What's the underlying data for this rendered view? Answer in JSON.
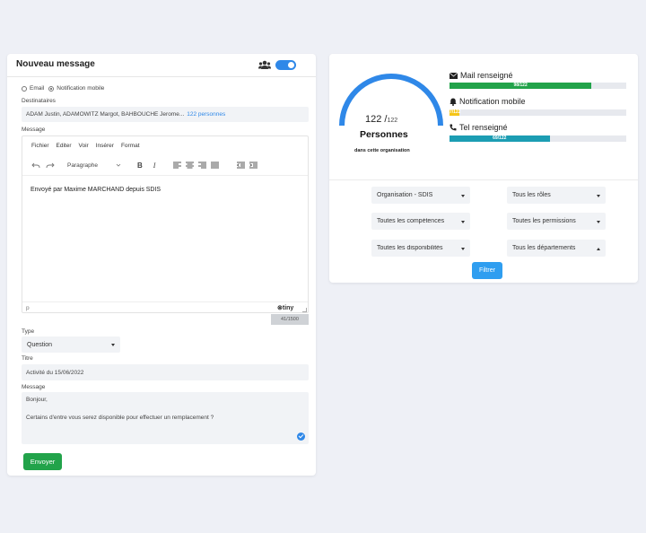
{
  "compose": {
    "title": "Nouveau message",
    "channel_email": "Email",
    "channel_notification": "Notification mobile",
    "recipients_label": "Destinataires",
    "recipients_value": "ADAM Justin, ADAMOWITZ Margot, BAHBOUCHE Jerome...",
    "recipients_count_link": "122 personnes",
    "message_label": "Message",
    "editor": {
      "menu": [
        "Fichier",
        "Editer",
        "Voir",
        "Insérer",
        "Format"
      ],
      "block_format": "Paragraphe",
      "content": "Envoyé par Maxime MARCHAND depuis SDIS",
      "status_path": "p",
      "brand": "tiny",
      "char_count": "41/1500"
    },
    "type_label": "Type",
    "type_value": "Question",
    "title_label": "Titre",
    "title_value": "Activité du 15/06/2022",
    "message2_label": "Message",
    "message2_line1": "Bonjour,",
    "message2_line2": "Certains d'entre vous serez disponible pour effectuer un remplacement ?",
    "send_label": "Envoyer"
  },
  "stats": {
    "gauge_value": "122 /",
    "gauge_total": "122",
    "gauge_fraction": 1.0,
    "gauge_title": "Personnes",
    "gauge_subtitle": "dans cette organisation",
    "mail_label": "Mail renseigné",
    "mail_bar": "98/122",
    "mail_fraction": 0.803,
    "notif_label": "Notification mobile",
    "notif_bar": "7/122",
    "notif_fraction": 0.057,
    "tel_label": "Tel renseigné",
    "tel_bar": "69/122",
    "tel_fraction": 0.566
  },
  "filters": {
    "organisation": "Organisation - SDIS",
    "roles": "Tous les rôles",
    "competences": "Toutes les compétences",
    "permissions": "Toutes les permissions",
    "disponibilites": "Toutes les disponibilités",
    "departements": "Tous les départements",
    "filter_button": "Filtrer"
  },
  "colors": {
    "accent_blue": "#2f88e8",
    "green": "#22a34a",
    "yellow": "#f5c518",
    "teal": "#1c9db3"
  }
}
